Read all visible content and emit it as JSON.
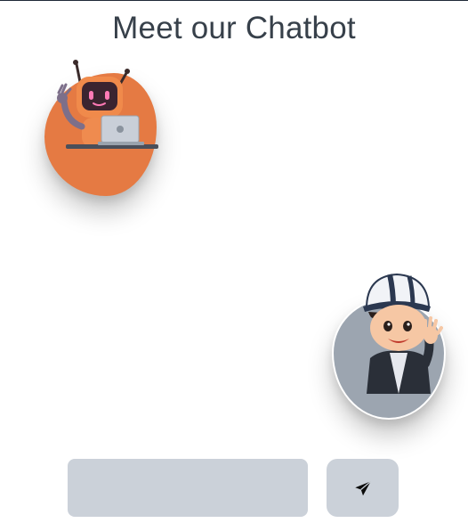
{
  "header": {
    "title": "Meet our Chatbot"
  },
  "chat": {
    "bot_avatar": {
      "icon": "robot-with-laptop-icon",
      "blob_color": "#e57a43"
    },
    "user_avatar": {
      "icon": "boy-waving-icon",
      "blob_color": "#9ca5b0"
    }
  },
  "composer": {
    "input_value": "",
    "input_placeholder": "",
    "send_icon": "paper-plane-icon",
    "field_color": "#cbd1d9"
  }
}
